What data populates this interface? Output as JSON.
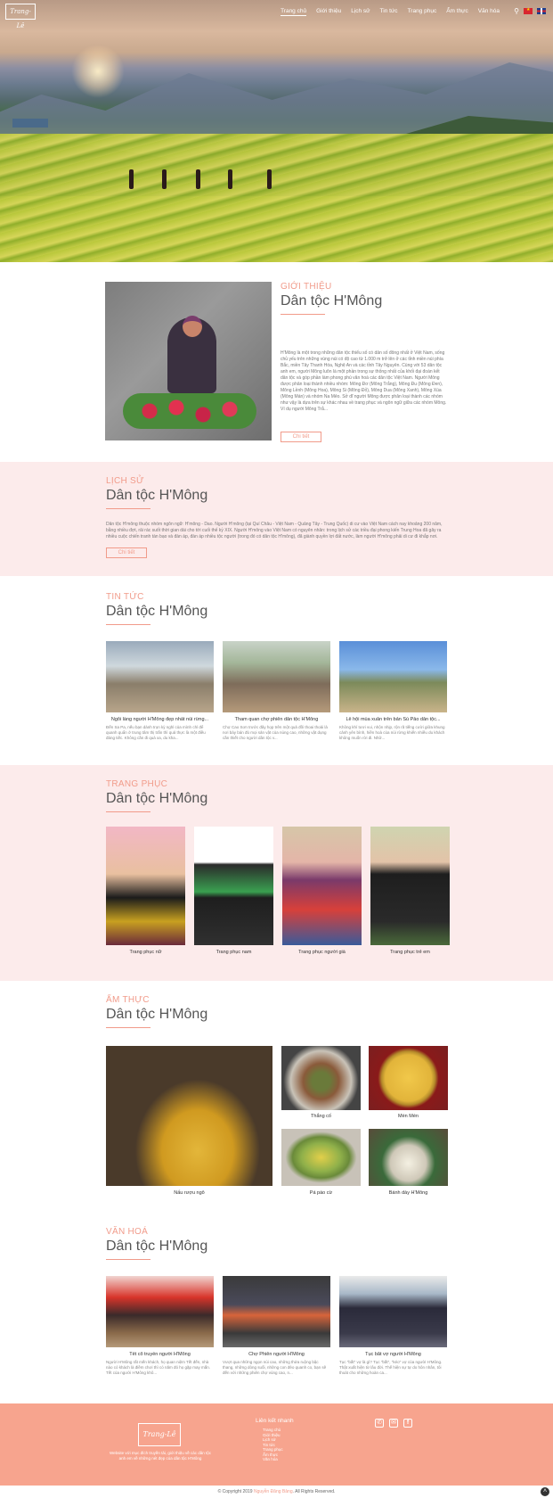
{
  "header": {
    "logo_text": "Trang-Lê",
    "nav": [
      "Trang chủ",
      "Giới thiệu",
      "Lịch sử",
      "Tin tức",
      "Trang phục",
      "Ẩm thực",
      "Văn hóa"
    ],
    "search_icon": "search-icon",
    "languages": [
      "vn-flag",
      "uk-flag"
    ]
  },
  "intro": {
    "label": "GIỚI THIỆU",
    "title": "Dân tộc H'Mông",
    "text": "H'Mông là một trong những dân tộc thiểu số có dân số đông nhất ở Việt Nam, sống chủ yếu trên những vùng núi có độ cao từ 1.000 m trở lên ở các tỉnh miền núi phía Bắc, miền Tây Thanh Hóa, Nghệ An và các tỉnh Tây Nguyên. Cùng với 53 dân tộc anh em, người Mông luôn là một phần trong sự thống nhất của khối đại đoàn kết dân tộc và góp phần làm phong phú văn hoá các dân tộc Việt Nam. Người Mông được phân loại thành nhiều nhóm: Mông Đơ (Mông Trắng), Mông Đu (Mông Đen), Mông Lềnh (Mông Hoa), Mông Si (Mông Đỏ), Mông Dua (Mông Xanh), Mông Xúa (Mông Mán) và nhóm Na Mẻo. Sở dĩ người Mông được phân loại thành các nhóm như vậy là dựa trên sự khác nhau về trang phục và ngôn ngữ giữa các nhóm Mông. Ví dụ người Mông Trắ...",
    "button": "Chi tiết"
  },
  "history": {
    "label": "LỊCH SỬ",
    "title": "Dân tộc H'Mông",
    "text": "Dân tộc H'mông thuộc nhóm ngôn ngữ: H'mông - Dao. Người H'mông (tại Quí Châu - Việt Nam - Quảng Tây - Trung Quốc) di cư vào Việt Nam cách nay khoảng 200 năm, bằng nhiều đợt, rải rác suốt thời gian dài cho tới cuối thế kỷ XIX. Người H'mông vào Việt Nam có nguyên nhân: trong lịch sử các triều đại phong kiến Trung Hoa đã gây ra nhiều cuộc chiến tranh tàn bạo và đàn áp, đàn áp nhiều tộc người (trong đó có dân tộc H'mông), đã giành quyền lợi đất nước, làm người H'mông phải di cư đi khắp nơi.",
    "button": "Chi tiết"
  },
  "news": {
    "label": "TIN TỨC",
    "title": "Dân tộc H'Mông",
    "items": [
      {
        "title": "Ngôi làng người H'Mông đẹp nhất núi rừng...",
        "desc": "Đến Sa Pa, nếu bạn dành trọn kỳ nghỉ của mình chỉ để quanh quẩn ở trung tâm thị trấn thì quả thực là một điều đáng tiếc. Không cần đi quá xa, du kha..."
      },
      {
        "title": "Tham quan chợ phiên dân tộc H'Mông",
        "desc": "Chợ Cao Sơn trước đây họp trên một quả đồi thoai thoải là nơi bày bán đủ mọi sản vật của núng cao, những vật dụng cần thiết cho người dân tộc v..."
      },
      {
        "title": "Lễ hội mùa xuân trên bản Sủ Pảo dân tộc...",
        "desc": "Không khí tươi vui, nhộn nhịp, rộn rã tiếng cười giữa khung cảnh yên bình, hiền hoà của núi rừng khiến nhiều du khách không muốn rời đi. Nhữ..."
      }
    ]
  },
  "costume": {
    "label": "TRANG PHỤC",
    "title": "Dân tộc H'Mông",
    "items": [
      "Trang phục nữ",
      "Trang phục nam",
      "Trang phục người già",
      "Trang phục trẻ em"
    ]
  },
  "cuisine": {
    "label": "ẨM THỰC",
    "title": "Dân tộc H'Mông",
    "items": [
      "Nấu rượu ngô",
      "Thắng cố",
      "Mèn Mén",
      "Pá páo cừ",
      "Bánh dày H'Mông"
    ]
  },
  "culture": {
    "label": "VĂN HOÁ",
    "title": "Dân tộc H'Mông",
    "items": [
      {
        "title": "Tết cổ truyền người H'Mông",
        "desc": "Người H'Mông rất mến khách, họ quan niệm Tết đến, nhà nào có khách là điềm chơi thì có năm đó họ gặp may mắn. Tết của người H'Mông khô..."
      },
      {
        "title": "Chợ Phiên người H'Mông",
        "desc": "Vượt qua những ngọn núi cao, những thửa ruộng bậc thang, những dòng suối, những con đèo quanh co, bạn sẽ đến với những phiên chợ vùng cao, n..."
      },
      {
        "title": "Tục bắt vợ người H'Mông",
        "desc": "Tục \"bắt\" vợ là gì? Tục \"bắt\", \"kéo\" vợ của người H'Mông. Thật xuất hiện từ lâu đời. Thế hiện sự tự do hôn nhân, tôi thoát cho những hoàn ca..."
      }
    ]
  },
  "footer": {
    "logo_text": "Trang-Lê",
    "desc": "Website với mục đích truyền tải, giới thiệu về các dân tộc anh em về những nét đẹp của dân tộc H'Mông",
    "links_title": "Liên kết nhanh",
    "links": [
      "Trang chủ",
      "Giới thiệu",
      "Lịch sử",
      "Tin tức",
      "Trang phục",
      "Ẩm thực",
      "Văn hóa"
    ],
    "social_icons": [
      "phone-icon",
      "mail-icon",
      "facebook-icon"
    ],
    "copyright_prefix": "© Copyright 2019",
    "copyright_author": "Nguyễn Đăng Bảng",
    "copyright_suffix": ". All Rights Reserved."
  }
}
